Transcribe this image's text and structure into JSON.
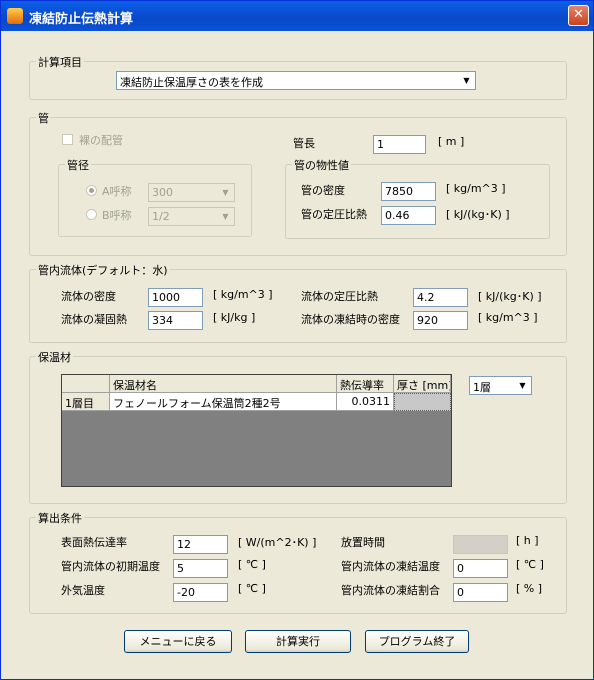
{
  "window": {
    "title": "凍結防止伝熱計算",
    "close_glyph": "✕"
  },
  "calc_item": {
    "group_label": "計算項目",
    "selected": "凍結防止保温厚さの表を作成"
  },
  "pipe": {
    "group_label": "管",
    "bare_pipe_label": "裸の配管",
    "pipe_length_label": "管長",
    "pipe_length_value": "1",
    "pipe_length_unit": "[ m ]",
    "diameter": {
      "group_label": "管径",
      "a_label": "A呼称",
      "a_value": "300",
      "b_label": "B呼称",
      "b_value": "1/2"
    },
    "properties": {
      "group_label": "管の物性値",
      "density_label": "管の密度",
      "density_value": "7850",
      "density_unit": "[ kg/m^3 ]",
      "cp_label": "管の定圧比熱",
      "cp_value": "0.46",
      "cp_unit": "[ kJ/(kg･K) ]"
    }
  },
  "fluid": {
    "group_label": "管内流体(デフォルト：水)",
    "density_label": "流体の密度",
    "density_value": "1000",
    "density_unit": "[ kg/m^3 ]",
    "cp_label": "流体の定圧比熱",
    "cp_value": "4.2",
    "cp_unit": "[ kJ/(kg･K) ]",
    "latent_label": "流体の凝固熱",
    "latent_value": "334",
    "latent_unit": "[ kJ/kg ]",
    "frozen_density_label": "流体の凍結時の密度",
    "frozen_density_value": "920",
    "frozen_density_unit": "[ kg/m^3 ]"
  },
  "insulation": {
    "group_label": "保温材",
    "columns": [
      "",
      "保温材名",
      "熱伝導率",
      "厚さ [mm]"
    ],
    "rows": [
      {
        "layer": "1層目",
        "name": "フェノールフォーム保温筒2種2号",
        "conductivity": "0.0311",
        "thickness": ""
      }
    ],
    "layer_select": "1層"
  },
  "conditions": {
    "group_label": "算出条件",
    "h_label": "表面熱伝達率",
    "h_value": "12",
    "h_unit": "[ W/(m^2･K) ]",
    "time_label": "放置時間",
    "time_value": "",
    "time_unit": "[ h ]",
    "init_temp_label": "管内流体の初期温度",
    "init_temp_value": "5",
    "init_temp_unit": "[ ℃ ]",
    "freeze_temp_label": "管内流体の凍結温度",
    "freeze_temp_value": "0",
    "freeze_temp_unit": "[ ℃ ]",
    "ambient_label": "外気温度",
    "ambient_value": "-20",
    "ambient_unit": "[ ℃ ]",
    "freeze_ratio_label": "管内流体の凍結割合",
    "freeze_ratio_value": "0",
    "freeze_ratio_unit": "[ % ]"
  },
  "buttons": {
    "menu": "メニューに戻る",
    "run": "計算実行",
    "exit": "プログラム終了"
  },
  "colors": {
    "titlebar": "#0a53d6",
    "face": "#ece9d8",
    "grid_empty": "#808080"
  }
}
